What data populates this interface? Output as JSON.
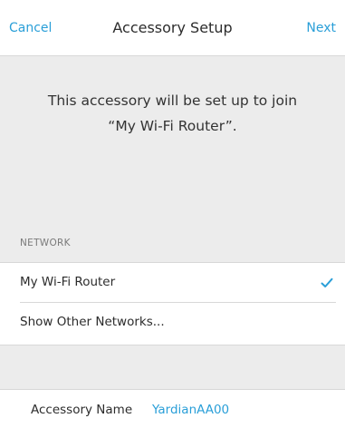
{
  "navbar": {
    "cancel_label": "Cancel",
    "title": "Accessory Setup",
    "next_label": "Next"
  },
  "message": {
    "line1": "This accessory will be set up to join",
    "line2": "“My Wi-Fi Router”."
  },
  "network_section": {
    "header": "NETWORK",
    "items": [
      {
        "label": "My Wi-Fi Router",
        "selected": true
      },
      {
        "label": "Show Other Networks..."
      }
    ]
  },
  "accessory": {
    "name_label": "Accessory Name",
    "name_value": "YardianAA00"
  },
  "colors": {
    "accent": "#2a9fd8",
    "background": "#ececec"
  },
  "icons": {
    "selected": "checkmark-icon"
  }
}
